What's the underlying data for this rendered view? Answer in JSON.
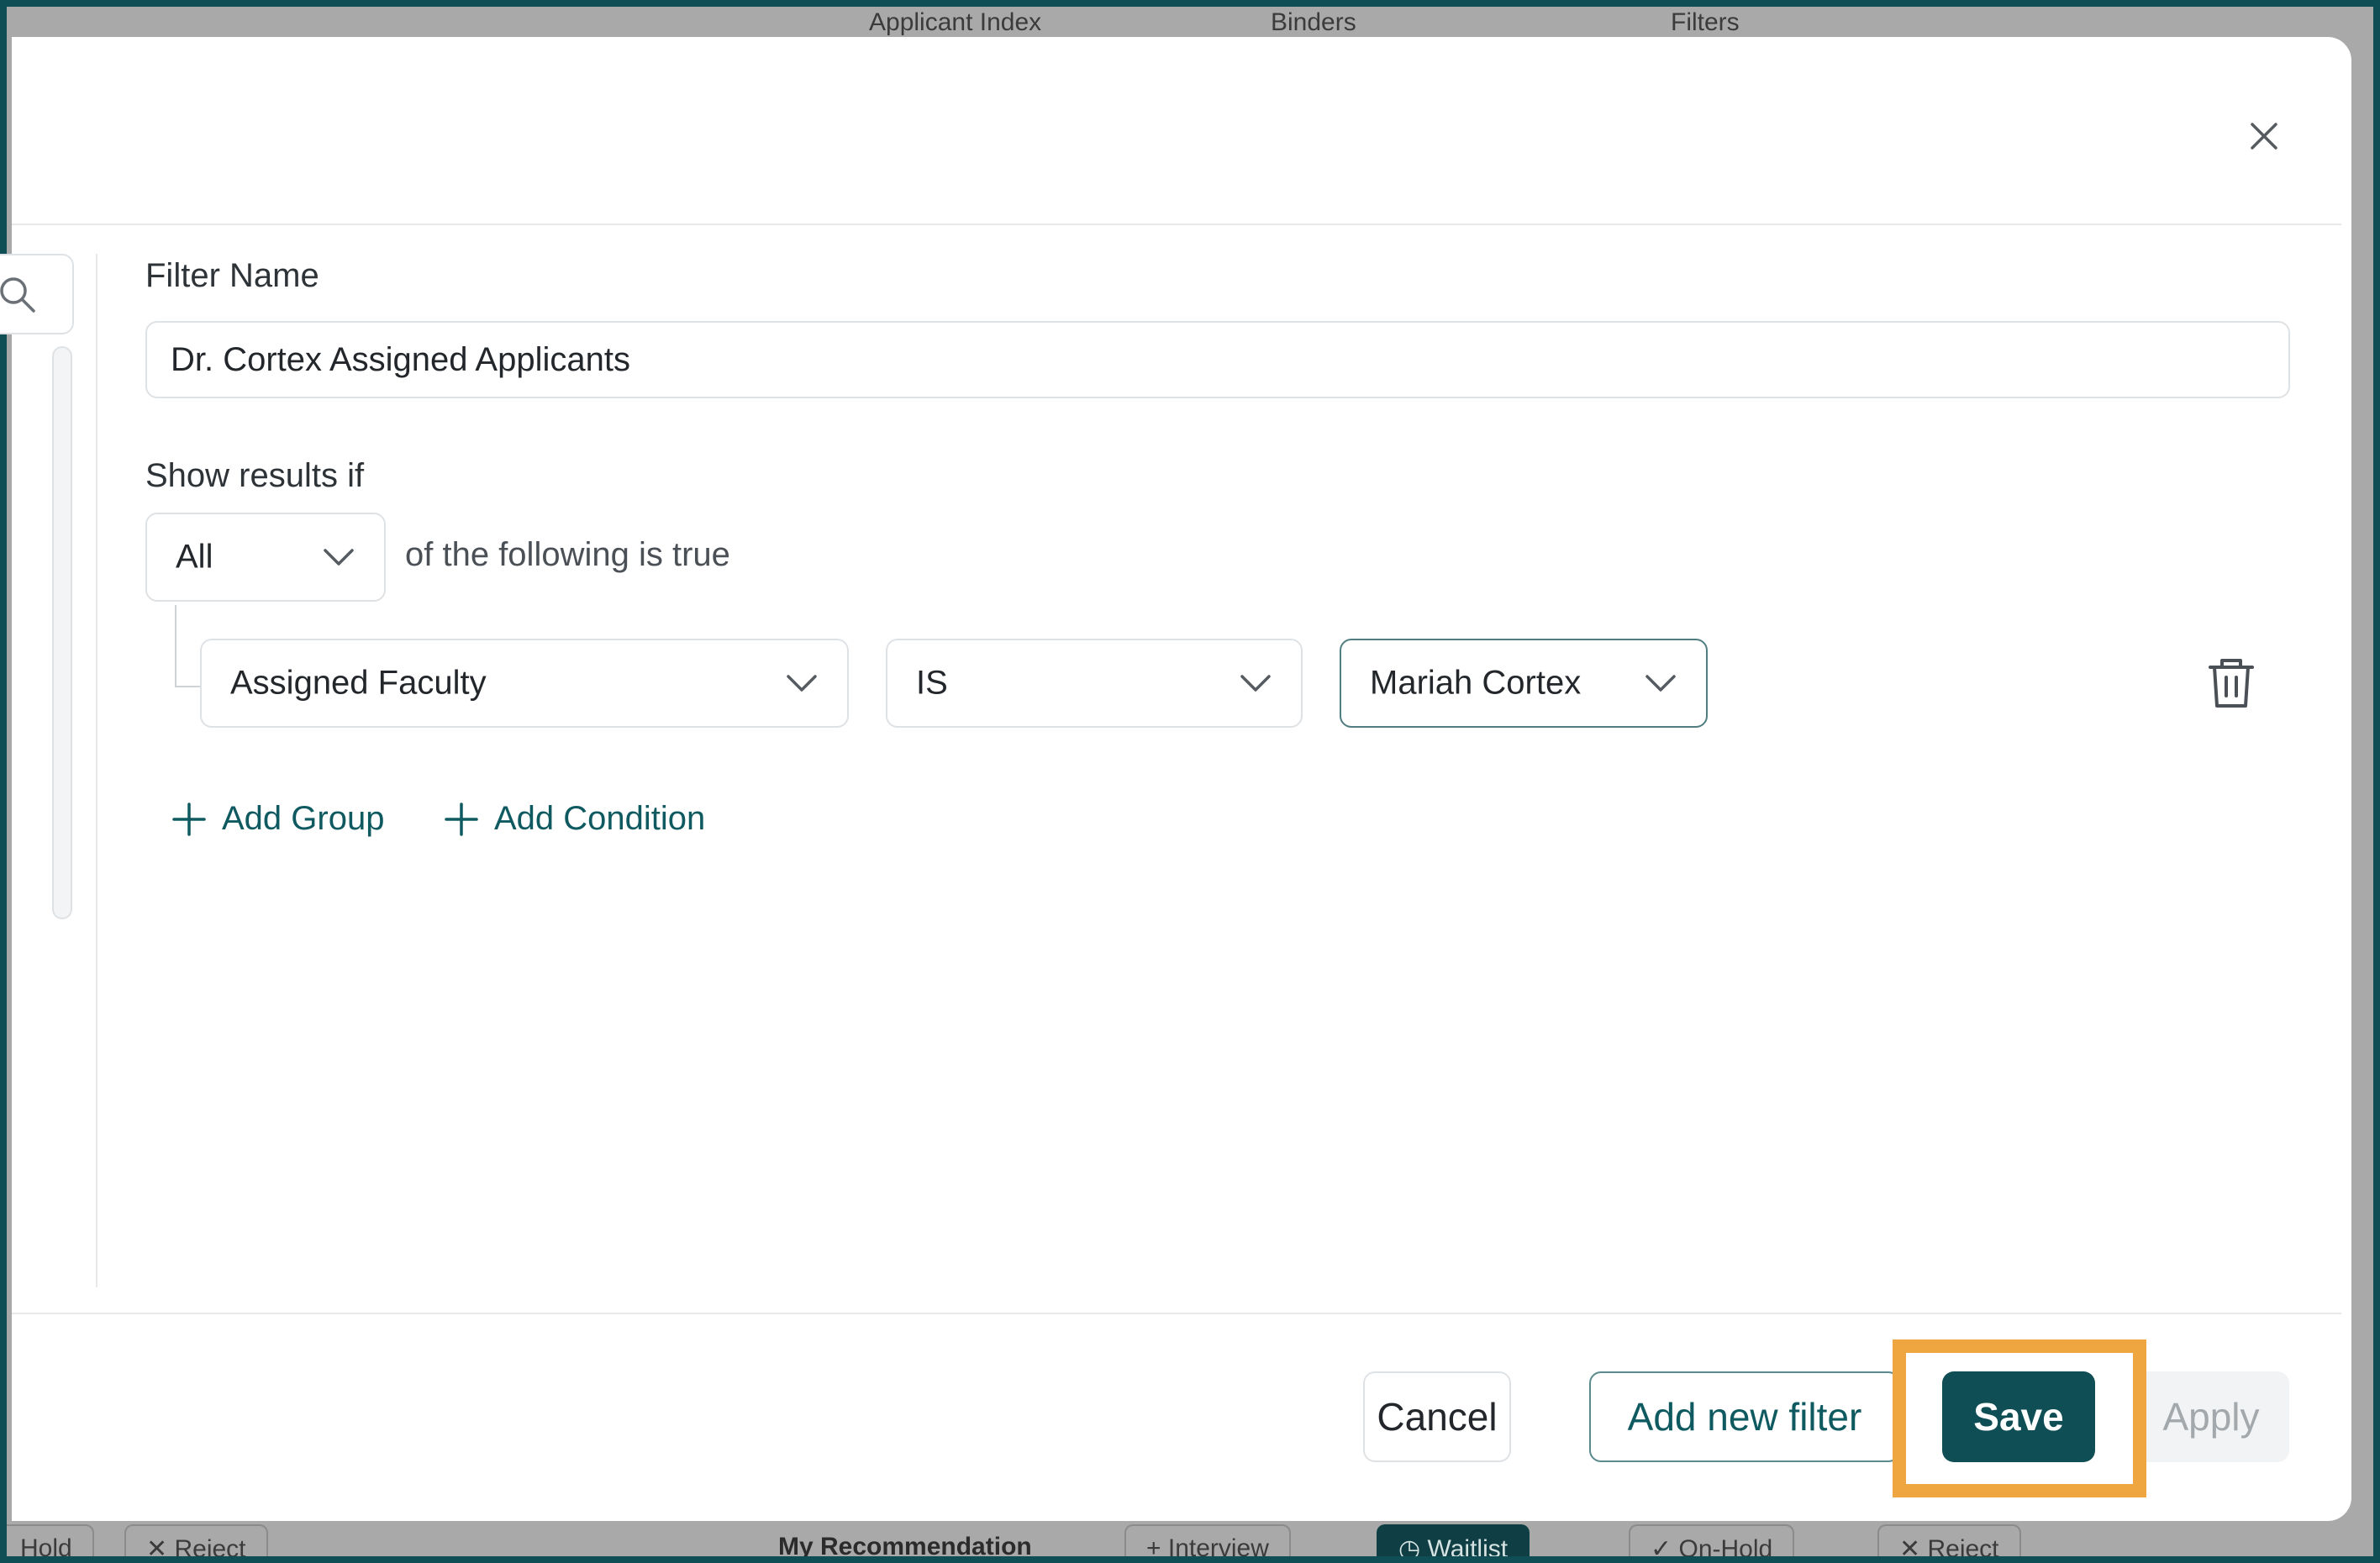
{
  "background": {
    "tabs": [
      "Applicant Index",
      "Binders",
      "Filters"
    ],
    "bottom_bar": {
      "left_items": [
        "Hold",
        "Reject"
      ],
      "recommendation_label": "My Recommendation",
      "actions": [
        "Interview",
        "Waitlist",
        "On-Hold",
        "Reject"
      ]
    }
  },
  "modal": {
    "filter_name_label": "Filter Name",
    "filter_name_value": "Dr. Cortex Assigned Applicants",
    "show_results_label": "Show results if",
    "match_mode": "All",
    "match_suffix": "of the following is true",
    "condition": {
      "field": "Assigned Faculty",
      "operator": "IS",
      "value": "Mariah Cortex"
    },
    "add_group_label": "Add Group",
    "add_condition_label": "Add Condition",
    "footer": {
      "cancel_label": "Cancel",
      "add_new_filter_label": "Add new filter",
      "save_label": "Save",
      "apply_label": "Apply"
    }
  },
  "colors": {
    "primary": "#0f4e55",
    "highlight": "#efa540",
    "link": "#0f5a60",
    "disabled_text": "#a3a8ad"
  }
}
